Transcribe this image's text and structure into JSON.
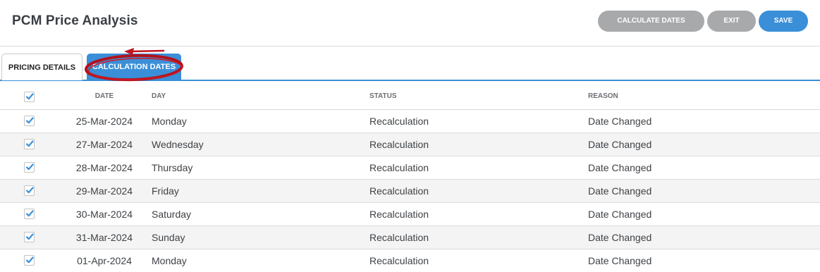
{
  "header": {
    "title": "PCM Price Analysis",
    "buttons": {
      "calculate_dates": "CALCULATE DATES",
      "exit": "EXIT",
      "save": "SAVE"
    }
  },
  "tabs": [
    {
      "label": "PRICING DETAILS",
      "active": false
    },
    {
      "label": "CALCULATION DATES",
      "active": true
    }
  ],
  "table": {
    "columns": [
      "",
      "DATE",
      "DAY",
      "STATUS",
      "REASON"
    ],
    "select_all_checked": true,
    "rows": [
      {
        "checked": true,
        "date": "25-Mar-2024",
        "day": "Monday",
        "status": "Recalculation",
        "reason": "Date Changed"
      },
      {
        "checked": true,
        "date": "27-Mar-2024",
        "day": "Wednesday",
        "status": "Recalculation",
        "reason": "Date Changed"
      },
      {
        "checked": true,
        "date": "28-Mar-2024",
        "day": "Thursday",
        "status": "Recalculation",
        "reason": "Date Changed"
      },
      {
        "checked": true,
        "date": "29-Mar-2024",
        "day": "Friday",
        "status": "Recalculation",
        "reason": "Date Changed"
      },
      {
        "checked": true,
        "date": "30-Mar-2024",
        "day": "Saturday",
        "status": "Recalculation",
        "reason": "Date Changed"
      },
      {
        "checked": true,
        "date": "31-Mar-2024",
        "day": "Sunday",
        "status": "Recalculation",
        "reason": "Date Changed"
      },
      {
        "checked": true,
        "date": "01-Apr-2024",
        "day": "Monday",
        "status": "Recalculation",
        "reason": "Date Changed"
      }
    ]
  },
  "colors": {
    "accent": "#3a8fd8",
    "button_gray": "#a7a9ab",
    "annotation_red": "#c1121f"
  },
  "icons": {
    "checkbox": "check-icon",
    "annotation": "red-ellipse-arrow-annotation"
  }
}
